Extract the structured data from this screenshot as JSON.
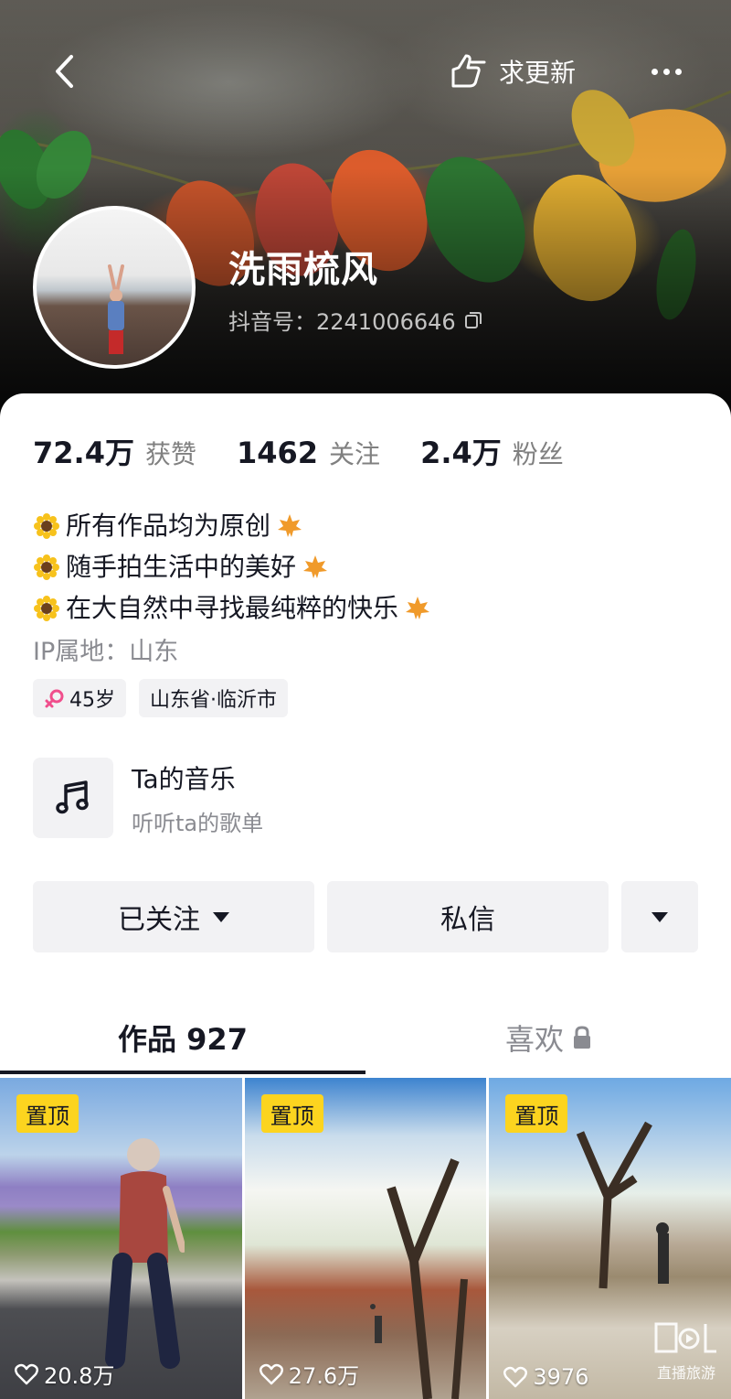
{
  "header": {
    "request_label": "求更新"
  },
  "profile": {
    "name": "洗雨梳风",
    "id_text": "抖音号：2241006646"
  },
  "stats": [
    {
      "value": "72.4万",
      "label": "获赞"
    },
    {
      "value": "1462",
      "label": "关注"
    },
    {
      "value": "2.4万",
      "label": "粉丝"
    }
  ],
  "bio": [
    "所有作品均为原创",
    "随手拍生活中的美好",
    "在大自然中寻找最纯粹的快乐"
  ],
  "ip_location": "IP属地：山东",
  "tags": {
    "age": "45岁",
    "location": "山东省·临沂市"
  },
  "music": {
    "title": "Ta的音乐",
    "subtitle": "听听ta的歌单"
  },
  "actions": {
    "follow_label": "已关注",
    "message_label": "私信"
  },
  "tabs": {
    "works_label": "作品 927",
    "likes_label": "喜欢"
  },
  "videos": [
    {
      "pin_label": "置顶",
      "likes": "20.8万"
    },
    {
      "pin_label": "置顶",
      "likes": "27.6万"
    },
    {
      "pin_label": "置顶",
      "likes": "3976"
    }
  ],
  "watermark": "直播旅游",
  "colors": {
    "pin_badge": "#fcd41f",
    "gender_female": "#f04e8c",
    "text_primary": "#161823",
    "text_secondary": "#8a8b91",
    "button_bg": "#f2f2f4"
  }
}
